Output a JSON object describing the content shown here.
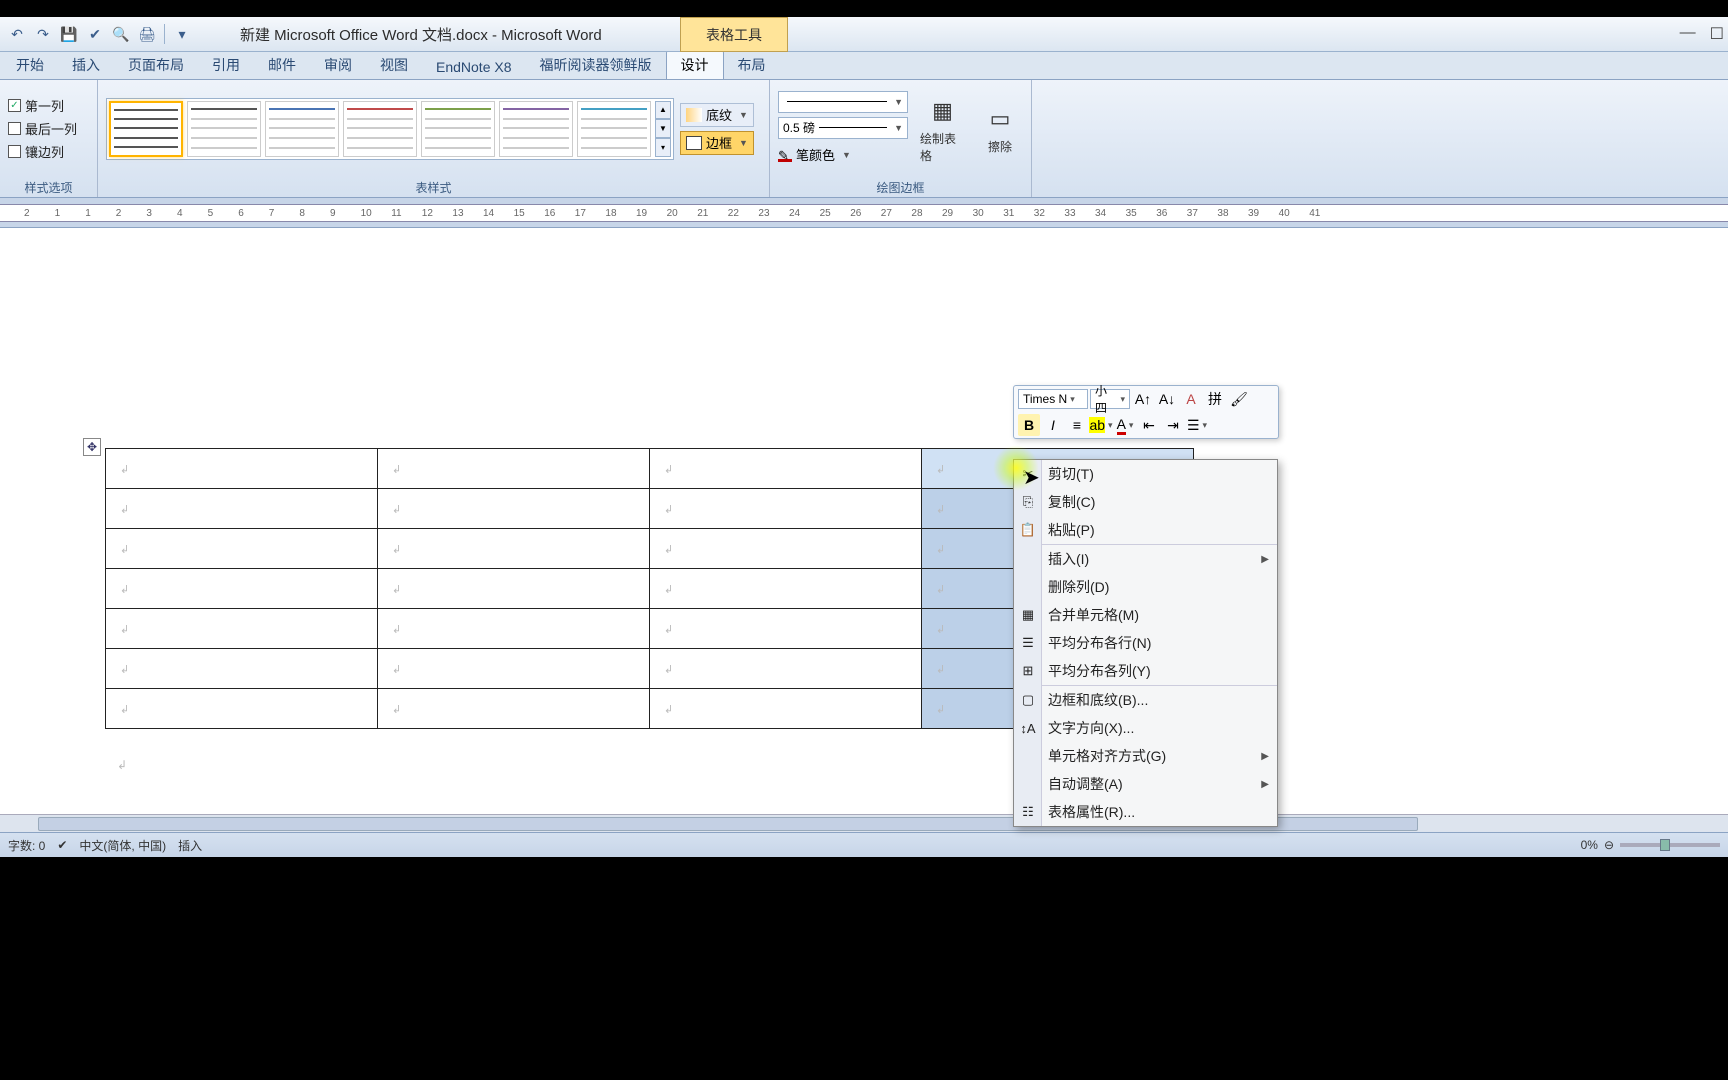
{
  "title": "新建 Microsoft Office Word 文档.docx - Microsoft Word",
  "context_tab_label": "表格工具",
  "tabs": [
    "开始",
    "插入",
    "页面布局",
    "引用",
    "邮件",
    "审阅",
    "视图",
    "EndNote X8",
    "福昕阅读器领鲜版",
    "设计",
    "布局"
  ],
  "active_tab_index": 9,
  "group1": {
    "first_col": "第一列",
    "last_col": "最后一列",
    "band_col": "镶边列",
    "label": "样式选项"
  },
  "group2": {
    "label": "表样式",
    "shading": "底纹",
    "border": "边框"
  },
  "group3": {
    "line_weight": "0.5 磅",
    "pen_color": "笔颜色",
    "draw_table": "绘制表格",
    "eraser": "擦除",
    "label": "绘图边框"
  },
  "mini_toolbar": {
    "font": "Times N",
    "size": "小四"
  },
  "context_menu": {
    "cut": "剪切(T)",
    "copy": "复制(C)",
    "paste": "粘贴(P)",
    "insert": "插入(I)",
    "delete_col": "删除列(D)",
    "merge_cells": "合并单元格(M)",
    "dist_rows": "平均分布各行(N)",
    "dist_cols": "平均分布各列(Y)",
    "borders_shading": "边框和底纹(B)...",
    "text_direction": "文字方向(X)...",
    "cell_align": "单元格对齐方式(G)",
    "autofit": "自动调整(A)",
    "table_props": "表格属性(R)..."
  },
  "status": {
    "word_count": "字数: 0",
    "language": "中文(简体, 中国)",
    "mode": "插入",
    "zoom_pct": "0%"
  },
  "ruler_marks": [
    "2",
    "1",
    "1",
    "2",
    "3",
    "4",
    "5",
    "6",
    "7",
    "8",
    "9",
    "10",
    "11",
    "12",
    "13",
    "14",
    "15",
    "16",
    "17",
    "18",
    "19",
    "20",
    "21",
    "22",
    "23",
    "24",
    "25",
    "26",
    "27",
    "28",
    "29",
    "30",
    "31",
    "32",
    "33",
    "34",
    "35",
    "36",
    "37",
    "38",
    "39",
    "40",
    "41"
  ],
  "cell_mark": "↲",
  "para_mark": "↲"
}
